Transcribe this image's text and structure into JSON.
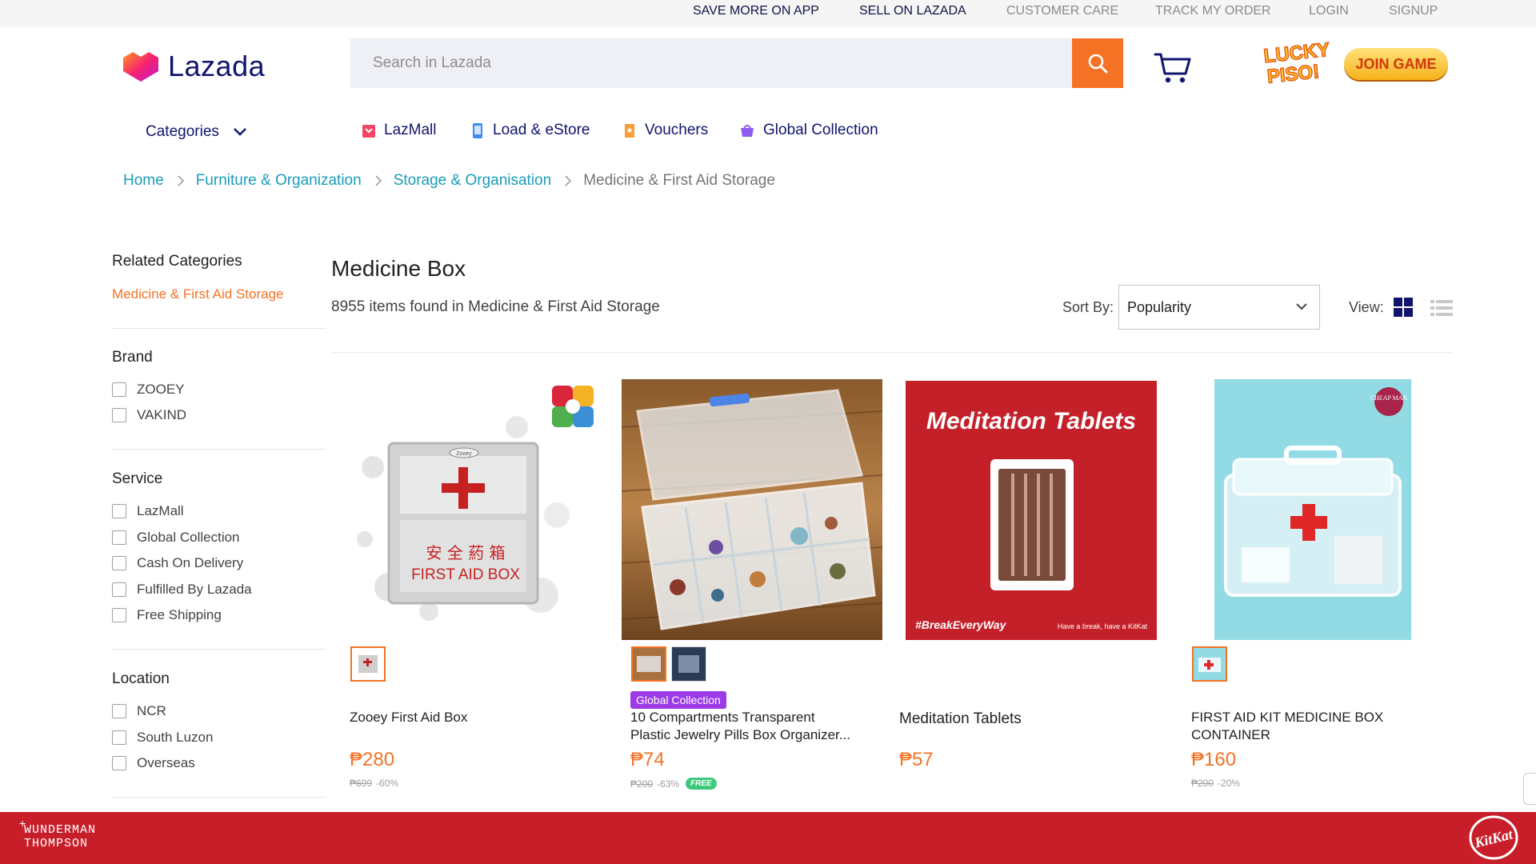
{
  "topbar": {
    "links": [
      "SAVE MORE ON APP",
      "SELL ON LAZADA",
      "CUSTOMER CARE",
      "TRACK MY ORDER",
      "LOGIN",
      "SIGNUP"
    ]
  },
  "header": {
    "brand": "Lazada",
    "search_placeholder": "Search in Lazada",
    "lucky_text": "LUCKY PISO!",
    "join_game_label": "JOIN GAME"
  },
  "nav": {
    "categories_label": "Categories",
    "items": [
      {
        "label": "LazMall",
        "icon": "lazmall-icon"
      },
      {
        "label": "Load & eStore",
        "icon": "phone-icon"
      },
      {
        "label": "Vouchers",
        "icon": "voucher-icon"
      },
      {
        "label": "Global Collection",
        "icon": "global-collection-icon"
      }
    ]
  },
  "breadcrumb": [
    "Home",
    "Furniture & Organization",
    "Storage & Organisation",
    "Medicine & First Aid Storage"
  ],
  "sidebar": {
    "related_title": "Related Categories",
    "related_active": "Medicine & First Aid Storage",
    "brand_title": "Brand",
    "brands": [
      "ZOOEY",
      "VAKIND"
    ],
    "service_title": "Service",
    "services": [
      "LazMall",
      "Global Collection",
      "Cash On Delivery",
      "Fulfilled By Lazada",
      "Free Shipping"
    ],
    "location_title": "Location",
    "locations": [
      "NCR",
      "South Luzon",
      "Overseas"
    ]
  },
  "main": {
    "title": "Medicine Box",
    "count_text": "8955 items found in Medicine & First Aid Storage",
    "sort_label": "Sort By:",
    "sort_value": "Popularity",
    "view_label": "View:"
  },
  "products": [
    {
      "name": "Zooey First Aid Box",
      "name_line2": "",
      "price": "₱280",
      "original": "₱699",
      "discount": "-60%",
      "image_text_top": "安 全 葯 箱",
      "image_text_bottom": "FIRST AID BOX",
      "image_label": "Zooey"
    },
    {
      "name": "10 Compartments Transparent",
      "name_line2": "Plastic Jewelry Pills Box Organizer...",
      "badge": "Global Collection",
      "price": "₱74",
      "original": "₱200",
      "discount": "-63%",
      "free_badge": "FREE"
    },
    {
      "name": "Meditation Tablets",
      "name_line2": "",
      "price": "₱57",
      "image_title": "Meditation Tablets",
      "image_hashtag": "#BreakEveryWay",
      "image_tagline": "Have a break, have a KitKat"
    },
    {
      "name": "FIRST AID KIT MEDICINE BOX",
      "name_line2": "CONTAINER",
      "price": "₱160",
      "original": "₱200",
      "discount": "-20%",
      "image_label": "CHEAP MAX"
    }
  ],
  "footer": {
    "agency_line1": "WUNDERMAN",
    "agency_line2": "THOMPSON",
    "agency_plus": "+",
    "brand": "KitKat"
  },
  "colors": {
    "accent": "#f57224",
    "link": "#1a9cb7",
    "navy": "#0f146d",
    "footer_red": "#c71e2a",
    "badge_purple": "#9b3be6"
  }
}
